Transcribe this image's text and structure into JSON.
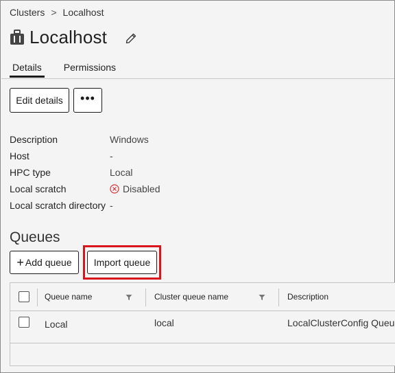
{
  "breadcrumb": {
    "parent": "Clusters",
    "separator": ">",
    "current": "Localhost"
  },
  "page": {
    "title": "Localhost",
    "title_icon": "cluster-icon",
    "edit_icon": "pencil-icon"
  },
  "tabs": [
    {
      "label": "Details",
      "active": true
    },
    {
      "label": "Permissions",
      "active": false
    }
  ],
  "actions": {
    "edit_label": "Edit details",
    "more_label": "•••"
  },
  "details": [
    {
      "label": "Description",
      "value": "Windows"
    },
    {
      "label": "Host",
      "value": "-"
    },
    {
      "label": "HPC type",
      "value": "Local"
    },
    {
      "label": "Local scratch",
      "value": "Disabled",
      "icon": "disabled-x-icon"
    },
    {
      "label": "Local scratch directory",
      "value": "-"
    }
  ],
  "queues": {
    "heading": "Queues",
    "add_label": "Add queue",
    "import_label": "Import queue",
    "columns": [
      "Queue name",
      "Cluster queue name",
      "Description"
    ],
    "rows": [
      {
        "name": "Local",
        "cluster_queue_name": "local",
        "description": "LocalClusterConfig Queue"
      }
    ]
  },
  "colors": {
    "highlight": "#d9141b",
    "border": "#c4c4c4",
    "background": "#f4f4f4",
    "disabled_icon": "#d13438"
  }
}
